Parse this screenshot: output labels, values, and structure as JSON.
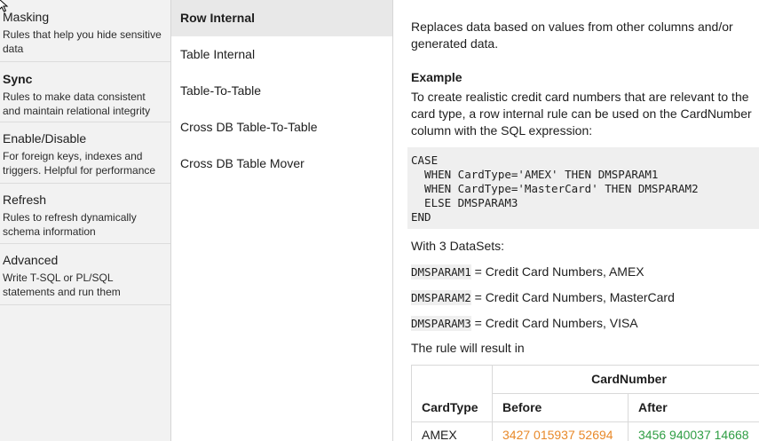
{
  "categories": [
    {
      "title": "Masking",
      "description": "Rules that help you hide sensitive data",
      "selected": false
    },
    {
      "title": "Sync",
      "description": "Rules to make data consistent and maintain relational integrity",
      "selected": true
    },
    {
      "title": "Enable/Disable",
      "description": "For foreign keys, indexes and triggers. Helpful for performance",
      "selected": false
    },
    {
      "title": "Refresh",
      "description": "Rules to refresh dynamically schema information",
      "selected": false
    },
    {
      "title": "Advanced",
      "description": "Write T-SQL or PL/SQL statements and run them",
      "selected": false
    }
  ],
  "rule_types": [
    {
      "label": "Row Internal",
      "selected": true
    },
    {
      "label": "Table Internal",
      "selected": false
    },
    {
      "label": "Table-To-Table",
      "selected": false
    },
    {
      "label": "Cross DB Table-To-Table",
      "selected": false
    },
    {
      "label": "Cross DB Table Mover",
      "selected": false
    }
  ],
  "detail": {
    "intro": "Replaces data based on values from other columns and/or generated data.",
    "example_heading": "Example",
    "example_text": "To create realistic credit card numbers that are relevant to the card type, a row internal rule can be used on the CardNumber column with the SQL expression:",
    "sql_code": "CASE\n  WHEN CardType='AMEX' THEN DMSPARAM1\n  WHEN CardType='MasterCard' THEN DMSPARAM2\n  ELSE DMSPARAM3\nEND",
    "datasets_intro": "With 3 DataSets:",
    "params": [
      {
        "name": "DMSPARAM1",
        "value": " = Credit Card Numbers, AMEX"
      },
      {
        "name": "DMSPARAM2",
        "value": " = Credit Card Numbers, MasterCard"
      },
      {
        "name": "DMSPARAM3",
        "value": " = Credit Card Numbers, VISA"
      }
    ],
    "result_intro": "The rule will result in",
    "table": {
      "group_header": "CardNumber",
      "col_cardtype": "CardType",
      "col_before": "Before",
      "col_after": "After",
      "rows": [
        {
          "cardtype": "AMEX",
          "before": "3427 015937 52694",
          "after": "3456 940037 14668"
        }
      ]
    }
  },
  "colors": {
    "before": "#e8892a",
    "after": "#2f9e44"
  }
}
